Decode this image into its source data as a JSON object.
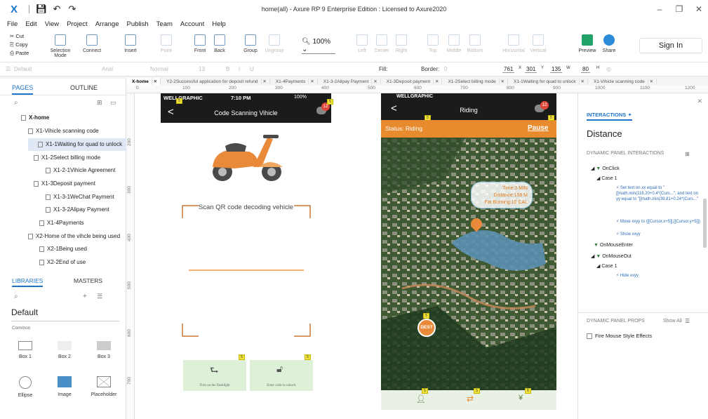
{
  "app": {
    "title": "home(all) - Axure RP 9 Enterprise Edition : Licensed to Axure2020",
    "window_controls": [
      "minimize-icon",
      "restore-icon",
      "close-icon"
    ]
  },
  "menu": [
    "File",
    "Edit",
    "View",
    "Project",
    "Arrange",
    "Publish",
    "Team",
    "Account",
    "Help"
  ],
  "toolbar": {
    "clip": [
      "Cut",
      "Copy",
      "Paste"
    ],
    "buttons": [
      {
        "label": "Selection Mode",
        "enabled": true
      },
      {
        "label": "Connect",
        "enabled": true
      },
      {
        "label": "Insert",
        "enabled": true
      },
      {
        "label": "Point",
        "enabled": false
      },
      {
        "label": "Front",
        "enabled": true
      },
      {
        "label": "Back",
        "enabled": true
      },
      {
        "label": "Group",
        "enabled": true
      },
      {
        "label": "Ungroup",
        "enabled": false
      },
      {
        "label": "Left",
        "enabled": false
      },
      {
        "label": "Center",
        "enabled": false
      },
      {
        "label": "Right",
        "enabled": false
      },
      {
        "label": "Top",
        "enabled": false
      },
      {
        "label": "Middle",
        "enabled": false
      },
      {
        "label": "Bottom",
        "enabled": false
      },
      {
        "label": "Horizontal",
        "enabled": false
      },
      {
        "label": "Vertical",
        "enabled": false
      },
      {
        "label": "Preview",
        "enabled": true
      },
      {
        "label": "Share",
        "enabled": true
      }
    ],
    "zoom": "100%",
    "signin": "Sign In"
  },
  "format": {
    "style": "Default",
    "font": "Arial",
    "weight": "Normal",
    "size": "13",
    "fill_label": "Fill:",
    "border_label": "Border:",
    "border_value": "0",
    "x": "761",
    "y": "301",
    "w": "135",
    "h": "80",
    "x_label": "X",
    "y_label": "Y",
    "w_label": "W",
    "h_label": "H"
  },
  "pages_panel": {
    "tabs": [
      "PAGES",
      "OUTLINE"
    ],
    "items": [
      "X-home",
      "X1-Vihicle scanning code",
      "X1-1Waiting for quad to unlock",
      "X1-2Select billing mode",
      "X1-2-1Vihicle Agreement",
      "X1-3Deposit payment",
      "X1-3-1WeChat Payment",
      "X1-3-2Alipay Payment",
      "X1-4Payments",
      "X2-Home of the vihcle being used",
      "X2-1Being used",
      "X2-2End of use"
    ]
  },
  "libraries_panel": {
    "tabs": [
      "LIBRARIES",
      "MASTERS"
    ],
    "library": "Default",
    "group": "Common",
    "shapes": [
      "Box 1",
      "Box 2",
      "Box 3",
      "Ellipse",
      "Image",
      "Placeholder"
    ]
  },
  "doc_tabs": [
    "X-home",
    "Y2-2Successful application for deposit refund",
    "X1-4Payments",
    "X1-3-2Alipay Payment",
    "X1-3Deposit payment",
    "X1-2Select billing mode",
    "X1-1Waiting for quad to unlock",
    "X1-Vihicle scanning code"
  ],
  "ruler": {
    "h": [
      "0",
      "100",
      "200",
      "300",
      "400",
      "500",
      "600",
      "700",
      "800",
      "900",
      "1000",
      "1100",
      "1200"
    ],
    "v": [
      "200",
      "300",
      "400",
      "500",
      "600",
      "700"
    ]
  },
  "phone1": {
    "carrier": "WELLGRAPHIC",
    "time": "7:10 PM",
    "battery": "100%",
    "title": "Code Scanning Vihicle",
    "badge": "12",
    "scan_text": "Scan QR code decoding vehicle",
    "btn_flashlight": "Turn on the flashlight",
    "btn_code": "Enter code to unlock"
  },
  "phone2": {
    "carrier": "WELLGRAPHIC",
    "title": "Riding",
    "badge": "12",
    "status": "Status: Riding",
    "pause": "Pause",
    "info": [
      "Time:3 MIN",
      "Distance:158 M",
      "Fat Burning:10 CAL"
    ],
    "dest": "DEST"
  },
  "inspector": {
    "tab": "INTERACTIONS",
    "title": "Distance",
    "section": "DYNAMIC PANEL INTERACTIONS",
    "events": [
      {
        "event": "OnClick",
        "case": "Case 1",
        "actions": [
          "Set text on xx equal to \"[[math.min(116.20+0.4*(Curs...\", and text on yy equal to \"[[math.min(39.81+0.24*(Curs...\"",
          "Move xxyy to ([[Cursor.x+5]],[[Cursor.y+5]])",
          "Show xxyy"
        ]
      },
      {
        "event": "OnMouseEnter"
      },
      {
        "event": "OnMouseOut",
        "case": "Case 1",
        "actions": [
          "Hide xxyy"
        ]
      }
    ],
    "props_title": "DYNAMIC PANEL PROPS",
    "show_all": "Show All",
    "checkbox": "Fire Mouse Style Effects"
  },
  "colors": {
    "accent": "#1e74c9",
    "orange": "#e88b2e",
    "phone_header": "#1b1b1b"
  }
}
